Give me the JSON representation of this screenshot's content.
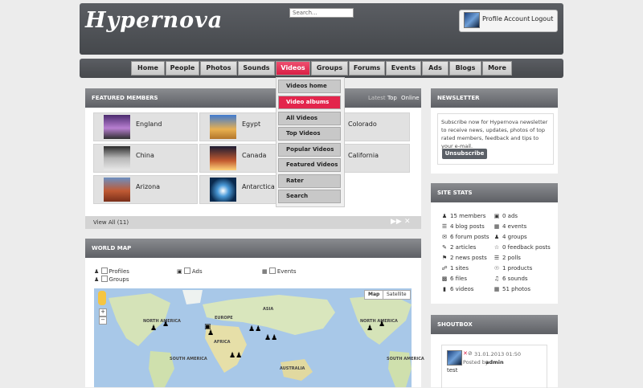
{
  "header": {
    "logo": "Hypernova",
    "search_placeholder": "Search...",
    "user_links": [
      "Profile",
      "Account",
      "Logout"
    ]
  },
  "nav": {
    "items": [
      "Home",
      "People",
      "Photos",
      "Sounds",
      "Videos",
      "Groups",
      "Forums",
      "Events",
      "Ads",
      "Blogs",
      "More"
    ],
    "active": "Videos"
  },
  "videos_menu": {
    "items": [
      "Videos home",
      "Video albums",
      "All Videos",
      "Top Videos",
      "Popular Videos",
      "Featured Videos",
      "Rater",
      "Search"
    ],
    "active": "Video albums"
  },
  "featured": {
    "title": "FEATURED MEMBERS",
    "tabs": [
      "Latest",
      "Top",
      "Online"
    ],
    "members": [
      "England",
      "Egypt",
      "Colorado",
      "China",
      "Canada",
      "California",
      "Arizona",
      "Antarctica"
    ],
    "view_all": "View All (11)"
  },
  "worldmap": {
    "title": "WORLD MAP",
    "filters": {
      "profiles": "Profiles",
      "groups": "Groups",
      "ads": "Ads",
      "events": "Events"
    },
    "map_button": "Map",
    "satellite_button": "Satellite",
    "labels": {
      "north_america_1": "NORTH AMERICA",
      "north_america_2": "NORTH AMERICA",
      "europe": "EUROPE",
      "asia": "ASIA",
      "africa": "AFRICA",
      "south_america_1": "SOUTH AMERICA",
      "south_america_2": "SOUTH AMERICA",
      "australia": "AUSTRALIA"
    }
  },
  "newsletter": {
    "title": "NEWSLETTER",
    "text": "Subscribe now for Hypernova newsletter to receive news, updates, photos of top rated members, feedback and tips to your e-mail.",
    "button": "Unsubscribe"
  },
  "site_stats": {
    "title": "SITE STATS",
    "left": [
      "15 members",
      "4 blog posts",
      "6 forum posts",
      "2 articles",
      "2 news posts",
      "1 sites",
      "6 files",
      "6 videos"
    ],
    "right": [
      "0 ads",
      "4 events",
      "4 groups",
      "0 feedback posts",
      "2 polls",
      "1 products",
      "6 sounds",
      "51 photos"
    ]
  },
  "shoutbox": {
    "title": "SHOUTBOX",
    "date": "31.01.2013 01:50",
    "posted_by_label": "Posted by",
    "author": "admin",
    "message": "test"
  },
  "colors": {
    "accent": "#e3254c",
    "header_bg": "#4f5256",
    "panel_head": "#6e7075"
  }
}
